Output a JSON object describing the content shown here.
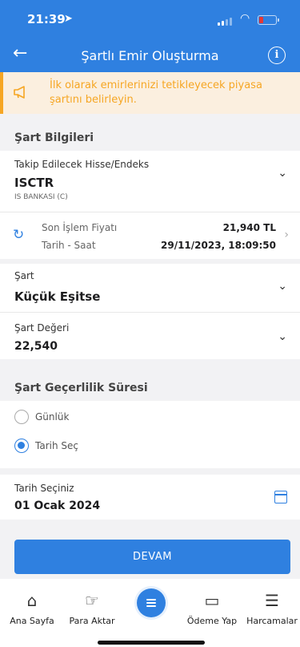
{
  "status_bar": {
    "time": "21:39"
  },
  "header": {
    "title": "Şartlı Emir Oluşturma"
  },
  "notice": {
    "text": "İlk olarak emirlerinizi tetikleyecek piyasa şartını belirleyin.",
    "accent_color": "#f6a623"
  },
  "section_conditions": {
    "title": "Şart Bilgileri"
  },
  "instrument": {
    "label": "Takip Edilecek Hisse/Endeks",
    "symbol": "ISCTR",
    "name": "IS BANKASI (C)"
  },
  "last_price": {
    "label": "Son İşlem Fiyatı",
    "value": "21,940 TL",
    "datetime_label": "Tarih - Saat",
    "datetime": "29/11/2023, 18:09:50"
  },
  "condition": {
    "label": "Şart",
    "value": "Küçük Eşitse"
  },
  "condition_value": {
    "label": "Şart Değeri",
    "value": "22,540"
  },
  "section_validity": {
    "title": "Şart Geçerlilik Süresi"
  },
  "validity_options": [
    {
      "label": "Günlük",
      "selected": false
    },
    {
      "label": "Tarih Seç",
      "selected": true
    }
  ],
  "date_select": {
    "label": "Tarih Seçiniz",
    "value": "01 Ocak 2024"
  },
  "continue_button": {
    "label": "DEVAM"
  },
  "tabbar": {
    "items": [
      {
        "label": "Ana Sayfa",
        "icon": "home-icon"
      },
      {
        "label": "Para Aktar",
        "icon": "hand-coin-icon"
      },
      {
        "label": "",
        "icon": "menu-icon"
      },
      {
        "label": "Ödeme Yap",
        "icon": "payment-icon"
      },
      {
        "label": "Harcamalar",
        "icon": "receipt-icon"
      }
    ]
  },
  "colors": {
    "primary": "#2f80e0",
    "notice_bg": "#fbefdf",
    "notice_text": "#f6a623"
  }
}
